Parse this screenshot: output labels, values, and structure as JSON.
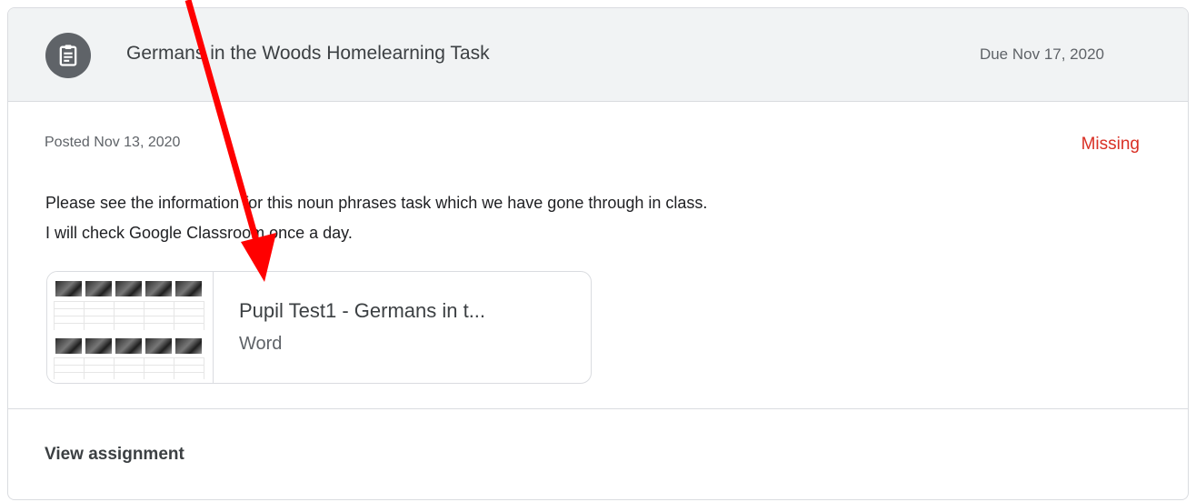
{
  "assignment": {
    "icon": "assignment-icon",
    "title": "Germans in the Woods Homelearning Task",
    "due": "Due Nov 17, 2020",
    "posted": "Posted Nov 13, 2020",
    "status": "Missing",
    "status_color": "#d93025",
    "description_line1": "Please see the information for this noun phrases task which we have gone through in class.",
    "description_line2": "I will check Google Classroom once a day."
  },
  "attachment": {
    "title": "Pupil Test1 - Germans in t...",
    "type": "Word"
  },
  "footer": {
    "view_label": "View assignment"
  },
  "annotation": {
    "color": "#ff0000"
  }
}
